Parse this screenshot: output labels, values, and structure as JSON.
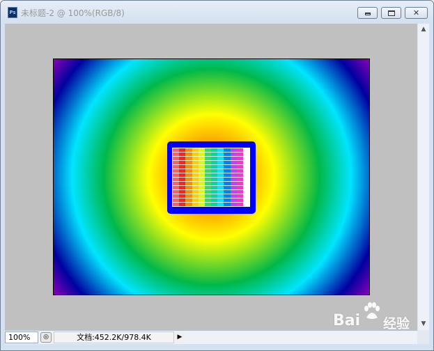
{
  "window": {
    "app_icon": "Ps",
    "title": "未标题-2 @ 100%(RGB/8)",
    "buttons": {
      "minimize_icon": "minimize-icon",
      "maximize_icon": "maximize-icon",
      "close_icon": "close-icon",
      "close_glyph": "✕"
    }
  },
  "canvas": {
    "background_color": "#c0c0c0",
    "gradient_colors": [
      "#ff2a00",
      "#ff8c00",
      "#ffff00",
      "#00b84a",
      "#00e5ff",
      "#0000a0",
      "#ff00cc"
    ],
    "inner_rect_color": "#0000ff",
    "stripe_colors": [
      "#ff6060",
      "#ff2020",
      "#ff8c00",
      "#ffd000",
      "#d8ff00",
      "#30e060",
      "#00d8a0",
      "#00e8ff",
      "#0080ff",
      "#c040ff",
      "#ff30d0",
      "#ffffff"
    ]
  },
  "scrollbar": {
    "up_glyph": "▲",
    "down_glyph": "▼"
  },
  "statusbar": {
    "zoom": "100%",
    "doc_info": "文档:452.2K/978.4K",
    "menu_arrow": "▶"
  },
  "watermark": {
    "text": "Bai",
    "text2": "经验"
  }
}
